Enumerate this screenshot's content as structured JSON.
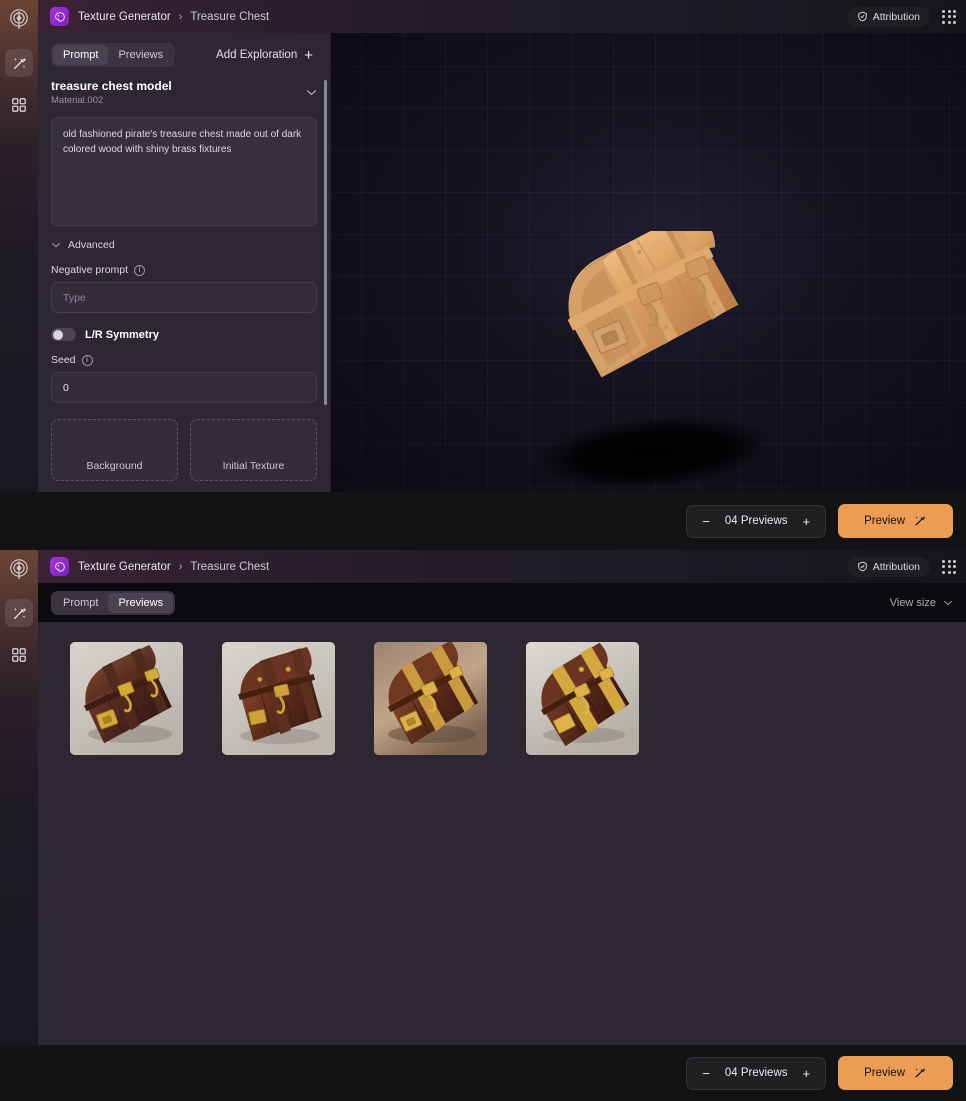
{
  "app": {
    "brand_icon": "palette-icon",
    "breadcrumb": {
      "root": "Texture Generator",
      "separator": "›",
      "current": "Treasure Chest"
    },
    "header_right": {
      "attribution_label": "Attribution",
      "attribution_icon": "shield-check-icon",
      "apps_icon": "grid-apps-icon"
    },
    "rail": {
      "logo_icon": "radar-logo-icon",
      "items": [
        {
          "icon": "magic-wand-icon",
          "active": true
        },
        {
          "icon": "grid-2x2-icon",
          "active": false
        }
      ]
    },
    "accent_color": "#eb9d55",
    "brand_color": "#a734e0",
    "panel_bg": "#2c2733",
    "viewport_bg": "#14121e"
  },
  "prompt_panel": {
    "tabs": [
      {
        "label": "Prompt",
        "active": true
      },
      {
        "label": "Previews",
        "active": false
      }
    ],
    "add_exploration": {
      "label": "Add Exploration",
      "icon": "plus-icon"
    },
    "material": {
      "title": "treasure chest model",
      "subtitle": "Material.002",
      "collapse_icon": "chevron-down-icon"
    },
    "prompt_text": "old fashioned pirate's treasure chest made out of dark colored wood with shiny brass fixtures",
    "advanced": {
      "label": "Advanced",
      "chevron_icon": "chevron-down-icon",
      "negative_prompt": {
        "label": "Negative prompt",
        "info_icon": "info-icon",
        "value": "",
        "placeholder": "Type"
      },
      "symmetry": {
        "label": "L/R Symmetry",
        "enabled": false
      },
      "seed": {
        "label": "Seed",
        "info_icon": "info-icon",
        "value": "0"
      },
      "uploads": [
        {
          "label": "Background"
        },
        {
          "label": "Initial Texture"
        }
      ]
    }
  },
  "viewport": {
    "model_name": "treasure-chest-3d-model",
    "grid_visible": true
  },
  "previews_panel": {
    "tabs": [
      {
        "label": "Prompt",
        "active": false
      },
      {
        "label": "Previews",
        "active": true
      }
    ],
    "view_size": {
      "label": "View size",
      "icon": "chevron-down-icon"
    },
    "thumbnails": [
      {
        "name": "preview-thumbnail-1"
      },
      {
        "name": "preview-thumbnail-2"
      },
      {
        "name": "preview-thumbnail-3"
      },
      {
        "name": "preview-thumbnail-4"
      }
    ]
  },
  "action_bar": {
    "decrement_icon": "minus-icon",
    "count_label": "04 Previews",
    "increment_icon": "plus-icon",
    "preview_button": {
      "label": "Preview",
      "icon": "magic-wand-icon"
    }
  }
}
